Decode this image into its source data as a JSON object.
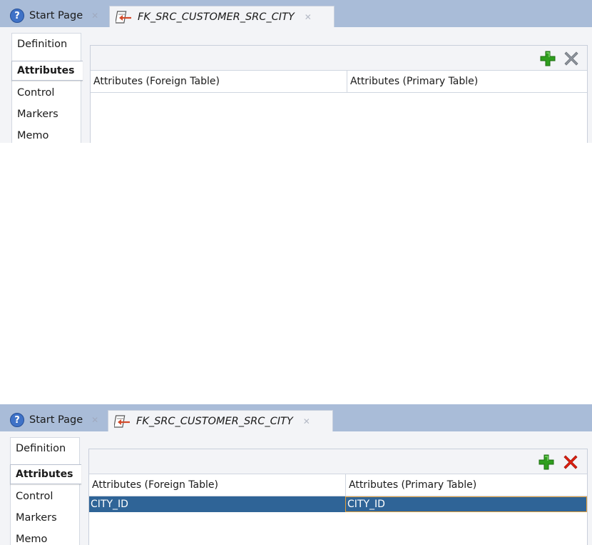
{
  "panels": [
    {
      "tabs": [
        {
          "label": "Start Page",
          "icon": "help-icon"
        },
        {
          "label": "FK_SRC_CUSTOMER_SRC_CITY",
          "icon": "foreign-key-icon"
        }
      ],
      "nav": [
        "Definition",
        "Attributes",
        "Control",
        "Markers",
        "Memo"
      ],
      "selected_nav": "Attributes",
      "columns": [
        "Attributes (Foreign Table)",
        "Attributes (Primary Table)"
      ],
      "rows": [],
      "remove_enabled": false
    },
    {
      "tabs": [
        {
          "label": "Start Page",
          "icon": "help-icon"
        },
        {
          "label": "FK_SRC_CUSTOMER_SRC_CITY",
          "icon": "foreign-key-icon"
        }
      ],
      "nav": [
        "Definition",
        "Attributes",
        "Control",
        "Markers",
        "Memo"
      ],
      "selected_nav": "Attributes",
      "columns": [
        "Attributes (Foreign Table)",
        "Attributes (Primary Table)"
      ],
      "rows": [
        {
          "foreign": "CITY_ID",
          "primary": "CITY_ID"
        }
      ],
      "remove_enabled": true
    }
  ],
  "colors": {
    "tabbar": "#a9bcd8",
    "selection": "#2f6497",
    "add_icon": "#2f9e1e",
    "remove_enabled": "#e02010",
    "remove_disabled": "#8e949c"
  }
}
